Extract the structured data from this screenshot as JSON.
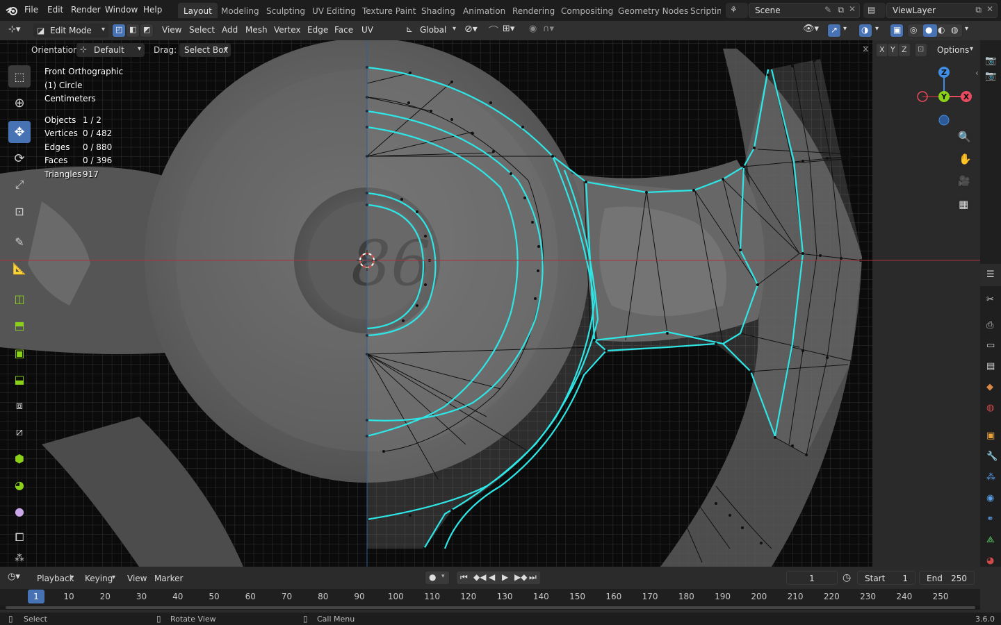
{
  "menu": {
    "file": "File",
    "edit": "Edit",
    "render": "Render",
    "window": "Window",
    "help": "Help"
  },
  "workspaces": [
    "Layout",
    "Modeling",
    "Sculpting",
    "UV Editing",
    "Texture Paint",
    "Shading",
    "Animation",
    "Rendering",
    "Compositing",
    "Geometry Nodes",
    "Scripting"
  ],
  "scene": {
    "name": "Scene",
    "view_layer": "ViewLayer"
  },
  "header": {
    "mode": "Edit Mode",
    "view": "View",
    "select": "Select",
    "add": "Add",
    "mesh": "Mesh",
    "vertex": "Vertex",
    "edge": "Edge",
    "face": "Face",
    "uv": "UV",
    "transform_orientation": "Global"
  },
  "tool_settings": {
    "orientation_label": "Orientation:",
    "orientation_value": "Default",
    "drag_label": "Drag:",
    "drag_value": "Select Box",
    "axes": [
      "X",
      "Y",
      "Z"
    ],
    "options": "Options"
  },
  "overlay_info": {
    "view_name": "Front Orthographic",
    "object_name": "(1) Circle",
    "units": "Centimeters",
    "stats": [
      {
        "label": "Objects",
        "value": "1 / 2"
      },
      {
        "label": "Vertices",
        "value": "0 / 482"
      },
      {
        "label": "Edges",
        "value": "0 / 880"
      },
      {
        "label": "Faces",
        "value": "0 / 396"
      },
      {
        "label": "Triangles",
        "value": "917"
      }
    ]
  },
  "gizmo": {
    "z": "Z",
    "y": "Y",
    "x": "X"
  },
  "timeline": {
    "playback": "Playback",
    "keying": "Keying",
    "view": "View",
    "marker": "Marker",
    "current_frame": "1",
    "start_label": "Start",
    "start": "1",
    "end_label": "End",
    "end": "250",
    "ticks": [
      "1",
      "10",
      "20",
      "30",
      "40",
      "50",
      "60",
      "70",
      "80",
      "90",
      "100",
      "110",
      "120",
      "130",
      "140",
      "150",
      "160",
      "170",
      "180",
      "190",
      "200",
      "210",
      "220",
      "230",
      "240",
      "250"
    ]
  },
  "status": {
    "select": "Select",
    "rotate": "Rotate View",
    "call_menu": "Call Menu",
    "version": "3.6.0"
  },
  "colors": {
    "accent": "#4772b3",
    "selection_edge": "#2ee6e6",
    "x_axis": "#e84a5f",
    "y_axis": "#8bd11a",
    "z_axis": "#3f8ee8"
  }
}
